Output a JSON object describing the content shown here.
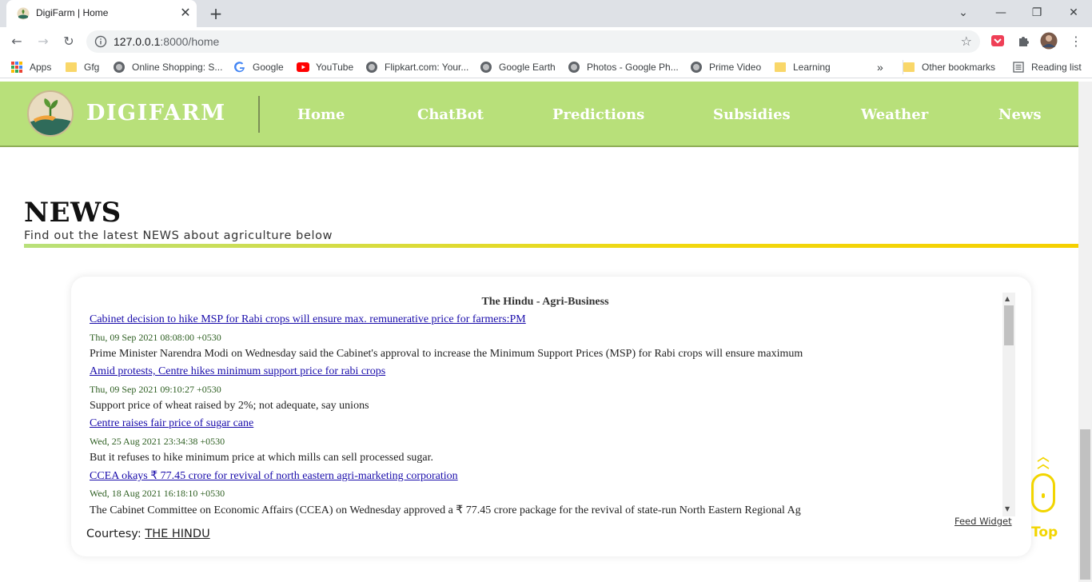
{
  "browser": {
    "tab_title": "DigiFarm | Home",
    "url_host": "127.0.0.1",
    "url_path": ":8000/home",
    "bookmarks": [
      {
        "label": "Apps",
        "icon": "apps-grid-icon"
      },
      {
        "label": "Gfg",
        "icon": "folder-icon"
      },
      {
        "label": "Online Shopping: S...",
        "icon": "globe-icon"
      },
      {
        "label": "Google",
        "icon": "google-icon"
      },
      {
        "label": "YouTube",
        "icon": "youtube-icon"
      },
      {
        "label": "Flipkart.com: Your...",
        "icon": "globe-icon"
      },
      {
        "label": "Google Earth",
        "icon": "globe-icon"
      },
      {
        "label": "Photos - Google Ph...",
        "icon": "globe-icon"
      },
      {
        "label": "Prime Video",
        "icon": "globe-icon"
      },
      {
        "label": "Learning",
        "icon": "folder-icon"
      }
    ],
    "overflow_label": "»",
    "other_bookmarks": "Other bookmarks",
    "reading_list": "Reading list"
  },
  "site": {
    "brand": "DIGIFARM",
    "nav": [
      "Home",
      "ChatBot",
      "Predictions",
      "Subsidies",
      "Weather",
      "News"
    ],
    "colors": {
      "header": "#b8e07a",
      "accent": "#f2d500"
    }
  },
  "news": {
    "title": "NEWS",
    "subtitle": "Find out the latest NEWS about agriculture below",
    "feed": {
      "title": "The Hindu - Agri-Business",
      "items": [
        {
          "headline": "Cabinet decision to hike MSP for Rabi crops will ensure max. remunerative price for farmers:PM",
          "date": "Thu, 09 Sep 2021 08:08:00 +0530",
          "summary": " Prime Minister Narendra Modi on Wednesday said the Cabinet's approval to increase the Minimum Support Prices (MSP) for Rabi crops will ensure maximum"
        },
        {
          "headline": "Amid protests, Centre hikes minimum support price for rabi crops",
          "date": "Thu, 09 Sep 2021 09:10:27 +0530",
          "summary": "Support price of wheat raised by 2%; not adequate, say unions"
        },
        {
          "headline": "Centre raises fair price of sugar cane",
          "date": "Wed, 25 Aug 2021 23:34:38 +0530",
          "summary": "But it refuses to hike minimum price at which mills can sell processed sugar."
        },
        {
          "headline": "CCEA okays ₹ 77.45 crore for revival of north eastern agri-marketing corporation",
          "date": "Wed, 18 Aug 2021 16:18:10 +0530",
          "summary": "The Cabinet Committee on Economic Affairs (CCEA) on Wednesday approved a ₹ 77.45 crore package for the revival of state-run North Eastern Regional Ag"
        }
      ],
      "widget_link": "Feed Widget"
    },
    "courtesy_label": "Courtesy:",
    "courtesy_link": "THE HINDU"
  },
  "top_button": {
    "label": "Top",
    "icon": "double-chevron-up-icon"
  }
}
